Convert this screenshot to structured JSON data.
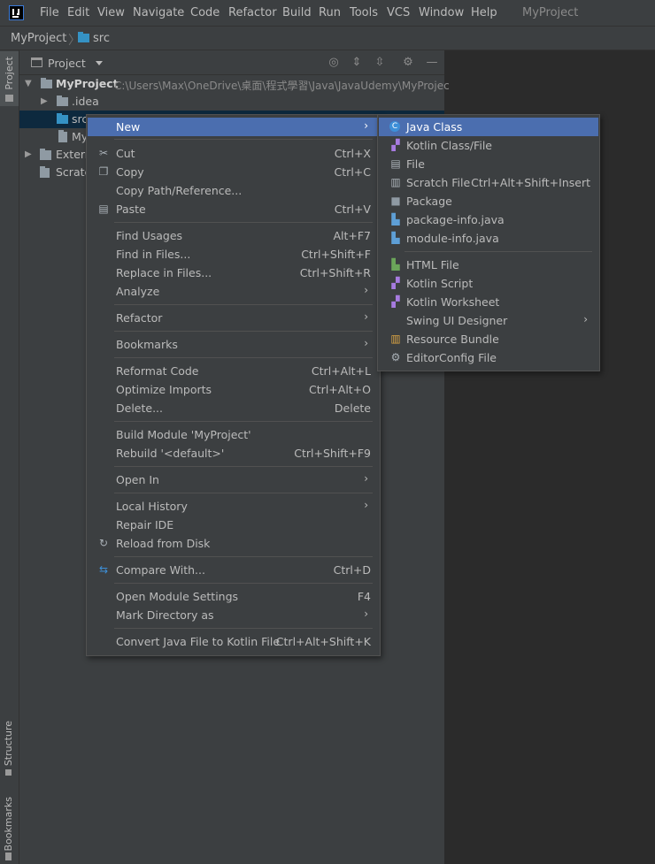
{
  "menubar": {
    "items": [
      "File",
      "Edit",
      "View",
      "Navigate",
      "Code",
      "Refactor",
      "Build",
      "Run",
      "Tools",
      "VCS",
      "Window",
      "Help"
    ],
    "window_title": "MyProject"
  },
  "navbar": {
    "project": "MyProject",
    "folder": "src"
  },
  "left_stripe": {
    "project_tab": "Project",
    "structure_tab": "Structure",
    "bookmarks_tab": "Bookmarks"
  },
  "project_panel": {
    "title": "Project",
    "tree": [
      {
        "label": "MyProject",
        "path": "C:\\Users\\Max\\OneDrive\\桌面\\程式學習\\Java\\JavaUdemy\\MyProjec"
      },
      {
        "label": ".idea"
      },
      {
        "label": "src"
      },
      {
        "label": "My"
      },
      {
        "label": "Extern"
      },
      {
        "label": "Scratc"
      }
    ]
  },
  "context_menu": {
    "items": [
      {
        "label": "New",
        "shortcut": "",
        "icon": "",
        "submenu": true
      },
      {
        "label": "Cut",
        "shortcut": "Ctrl+X",
        "icon": "scissors-icon"
      },
      {
        "label": "Copy",
        "shortcut": "Ctrl+C",
        "icon": "copy-icon"
      },
      {
        "label": "Copy Path/Reference...",
        "shortcut": ""
      },
      {
        "label": "Paste",
        "shortcut": "Ctrl+V",
        "icon": "clipboard-icon"
      },
      {
        "label": "Find Usages",
        "shortcut": "Alt+F7"
      },
      {
        "label": "Find in Files...",
        "shortcut": "Ctrl+Shift+F"
      },
      {
        "label": "Replace in Files...",
        "shortcut": "Ctrl+Shift+R"
      },
      {
        "label": "Analyze",
        "shortcut": "",
        "submenu": true
      },
      {
        "label": "Refactor",
        "shortcut": "",
        "submenu": true
      },
      {
        "label": "Bookmarks",
        "shortcut": "",
        "submenu": true
      },
      {
        "label": "Reformat Code",
        "shortcut": "Ctrl+Alt+L"
      },
      {
        "label": "Optimize Imports",
        "shortcut": "Ctrl+Alt+O"
      },
      {
        "label": "Delete...",
        "shortcut": "Delete"
      },
      {
        "label": "Build Module 'MyProject'",
        "shortcut": ""
      },
      {
        "label": "Rebuild '<default>'",
        "shortcut": "Ctrl+Shift+F9"
      },
      {
        "label": "Open In",
        "shortcut": "",
        "submenu": true
      },
      {
        "label": "Local History",
        "shortcut": "",
        "submenu": true
      },
      {
        "label": "Repair IDE",
        "shortcut": ""
      },
      {
        "label": "Reload from Disk",
        "shortcut": "",
        "icon": "reload-icon"
      },
      {
        "label": "Compare With...",
        "shortcut": "Ctrl+D",
        "icon": "compare-icon"
      },
      {
        "label": "Open Module Settings",
        "shortcut": "F4"
      },
      {
        "label": "Mark Directory as",
        "shortcut": "",
        "submenu": true
      },
      {
        "label": "Convert Java File to Kotlin File",
        "shortcut": "Ctrl+Alt+Shift+K"
      }
    ]
  },
  "submenu": {
    "items": [
      {
        "label": "Java Class",
        "shortcut": ""
      },
      {
        "label": "Kotlin Class/File",
        "shortcut": ""
      },
      {
        "label": "File",
        "shortcut": ""
      },
      {
        "label": "Scratch File",
        "shortcut": "Ctrl+Alt+Shift+Insert"
      },
      {
        "label": "Package",
        "shortcut": ""
      },
      {
        "label": "package-info.java",
        "shortcut": ""
      },
      {
        "label": "module-info.java",
        "shortcut": ""
      },
      {
        "label": "HTML File",
        "shortcut": ""
      },
      {
        "label": "Kotlin Script",
        "shortcut": ""
      },
      {
        "label": "Kotlin Worksheet",
        "shortcut": ""
      },
      {
        "label": "Swing UI Designer",
        "shortcut": "",
        "submenu": true
      },
      {
        "label": "Resource Bundle",
        "shortcut": ""
      },
      {
        "label": "EditorConfig File",
        "shortcut": ""
      }
    ]
  },
  "colors": {
    "selection": "#4b6eaf",
    "tree_selection": "#0d293e",
    "folder_blue": "#3592c4",
    "menu_bg": "#3c3f41",
    "editor_bg": "#2b2b2b"
  }
}
